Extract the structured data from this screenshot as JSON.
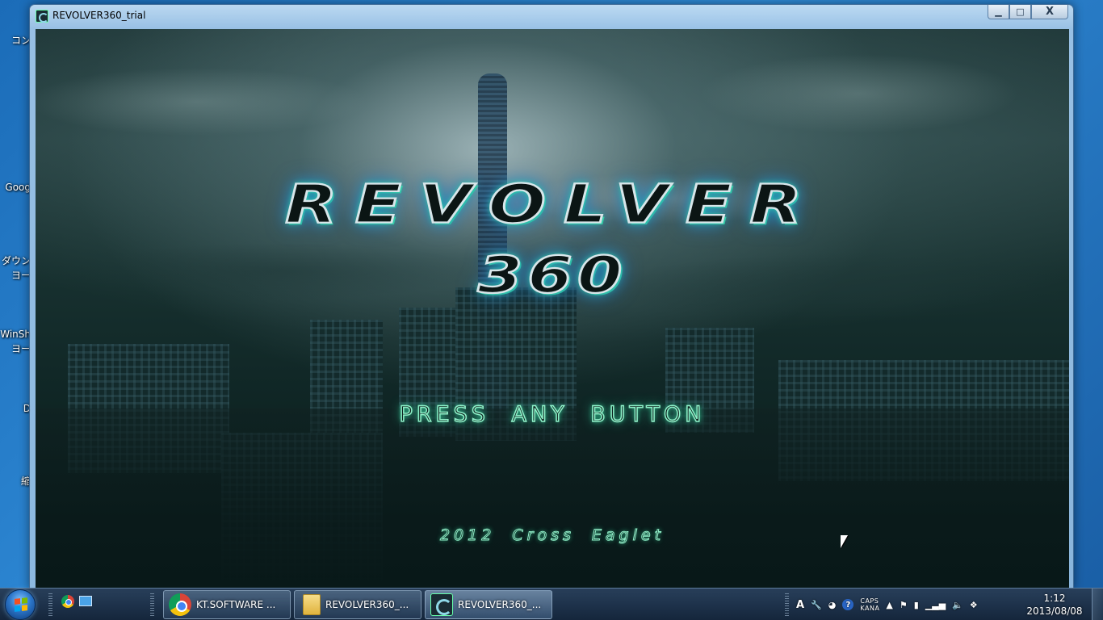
{
  "desktop": {
    "icons": [
      "コン",
      "Goog",
      "ダウン",
      "ヨー",
      "WinSh",
      "ヨー",
      "D",
      "縮"
    ]
  },
  "window": {
    "title": "REVOLVER360_trial",
    "minimize_label": "▁",
    "maximize_label": "□",
    "close_label": "X"
  },
  "game": {
    "logo_title": "REVOLVER",
    "logo_number": "360",
    "prompt": "PRESS ANY BUTTON",
    "copyright": "2012 Cross Eaglet"
  },
  "taskbar": {
    "tasks": [
      {
        "label": "KT.SOFTWARE ...",
        "icon": "chrome-icon"
      },
      {
        "label": "REVOLVER360_...",
        "icon": "folder-icon"
      },
      {
        "label": "REVOLVER360_...",
        "icon": "revolver-app-icon"
      }
    ],
    "tray": {
      "ime": "A",
      "help": "?",
      "caps": "CAPS",
      "kana": "KANA",
      "expand": "▲"
    },
    "clock_time": "1:12",
    "clock_date": "2013/08/08"
  }
}
